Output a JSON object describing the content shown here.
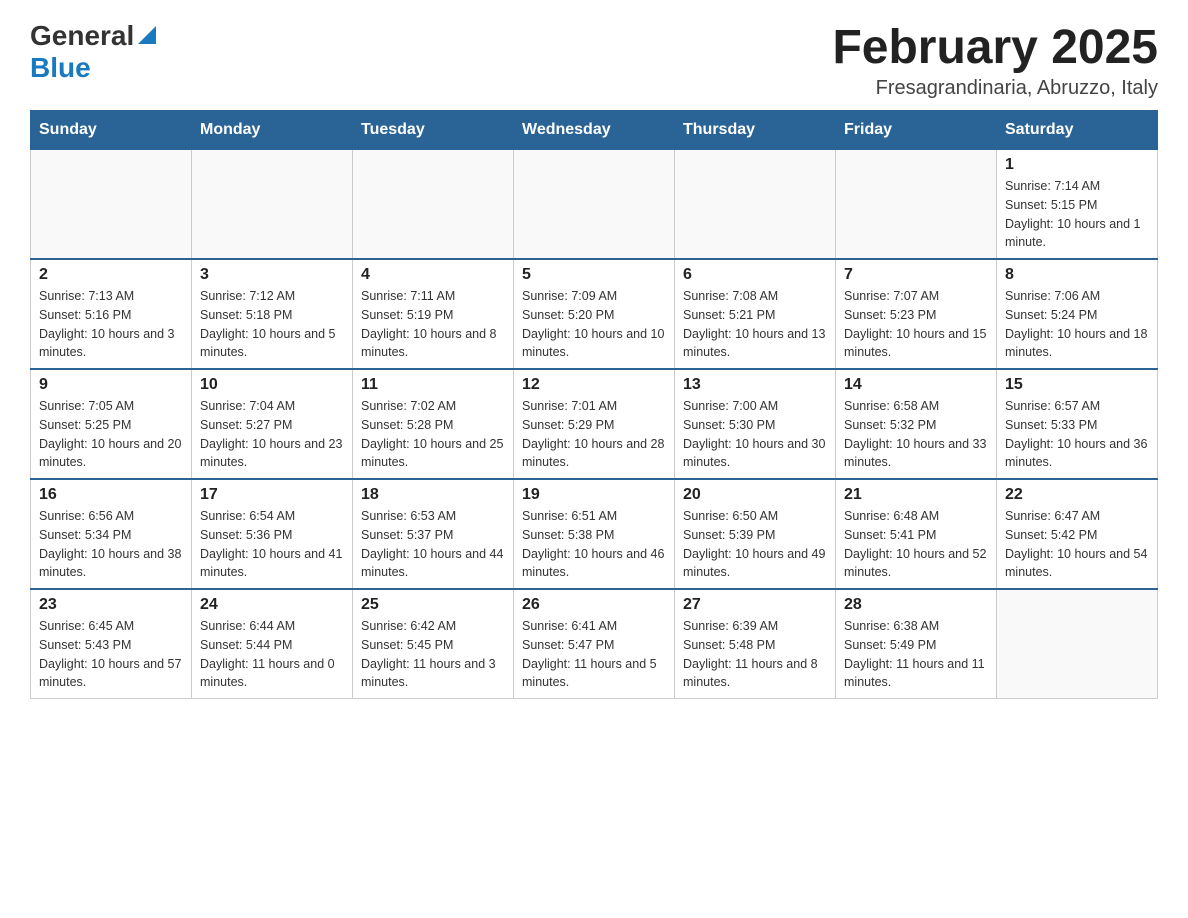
{
  "header": {
    "logo_general": "General",
    "logo_blue": "Blue",
    "title": "February 2025",
    "location": "Fresagrandinaria, Abruzzo, Italy"
  },
  "days_of_week": [
    "Sunday",
    "Monday",
    "Tuesday",
    "Wednesday",
    "Thursday",
    "Friday",
    "Saturday"
  ],
  "weeks": [
    [
      {
        "day": "",
        "sunrise": "",
        "sunset": "",
        "daylight": ""
      },
      {
        "day": "",
        "sunrise": "",
        "sunset": "",
        "daylight": ""
      },
      {
        "day": "",
        "sunrise": "",
        "sunset": "",
        "daylight": ""
      },
      {
        "day": "",
        "sunrise": "",
        "sunset": "",
        "daylight": ""
      },
      {
        "day": "",
        "sunrise": "",
        "sunset": "",
        "daylight": ""
      },
      {
        "day": "",
        "sunrise": "",
        "sunset": "",
        "daylight": ""
      },
      {
        "day": "1",
        "sunrise": "Sunrise: 7:14 AM",
        "sunset": "Sunset: 5:15 PM",
        "daylight": "Daylight: 10 hours and 1 minute."
      }
    ],
    [
      {
        "day": "2",
        "sunrise": "Sunrise: 7:13 AM",
        "sunset": "Sunset: 5:16 PM",
        "daylight": "Daylight: 10 hours and 3 minutes."
      },
      {
        "day": "3",
        "sunrise": "Sunrise: 7:12 AM",
        "sunset": "Sunset: 5:18 PM",
        "daylight": "Daylight: 10 hours and 5 minutes."
      },
      {
        "day": "4",
        "sunrise": "Sunrise: 7:11 AM",
        "sunset": "Sunset: 5:19 PM",
        "daylight": "Daylight: 10 hours and 8 minutes."
      },
      {
        "day": "5",
        "sunrise": "Sunrise: 7:09 AM",
        "sunset": "Sunset: 5:20 PM",
        "daylight": "Daylight: 10 hours and 10 minutes."
      },
      {
        "day": "6",
        "sunrise": "Sunrise: 7:08 AM",
        "sunset": "Sunset: 5:21 PM",
        "daylight": "Daylight: 10 hours and 13 minutes."
      },
      {
        "day": "7",
        "sunrise": "Sunrise: 7:07 AM",
        "sunset": "Sunset: 5:23 PM",
        "daylight": "Daylight: 10 hours and 15 minutes."
      },
      {
        "day": "8",
        "sunrise": "Sunrise: 7:06 AM",
        "sunset": "Sunset: 5:24 PM",
        "daylight": "Daylight: 10 hours and 18 minutes."
      }
    ],
    [
      {
        "day": "9",
        "sunrise": "Sunrise: 7:05 AM",
        "sunset": "Sunset: 5:25 PM",
        "daylight": "Daylight: 10 hours and 20 minutes."
      },
      {
        "day": "10",
        "sunrise": "Sunrise: 7:04 AM",
        "sunset": "Sunset: 5:27 PM",
        "daylight": "Daylight: 10 hours and 23 minutes."
      },
      {
        "day": "11",
        "sunrise": "Sunrise: 7:02 AM",
        "sunset": "Sunset: 5:28 PM",
        "daylight": "Daylight: 10 hours and 25 minutes."
      },
      {
        "day": "12",
        "sunrise": "Sunrise: 7:01 AM",
        "sunset": "Sunset: 5:29 PM",
        "daylight": "Daylight: 10 hours and 28 minutes."
      },
      {
        "day": "13",
        "sunrise": "Sunrise: 7:00 AM",
        "sunset": "Sunset: 5:30 PM",
        "daylight": "Daylight: 10 hours and 30 minutes."
      },
      {
        "day": "14",
        "sunrise": "Sunrise: 6:58 AM",
        "sunset": "Sunset: 5:32 PM",
        "daylight": "Daylight: 10 hours and 33 minutes."
      },
      {
        "day": "15",
        "sunrise": "Sunrise: 6:57 AM",
        "sunset": "Sunset: 5:33 PM",
        "daylight": "Daylight: 10 hours and 36 minutes."
      }
    ],
    [
      {
        "day": "16",
        "sunrise": "Sunrise: 6:56 AM",
        "sunset": "Sunset: 5:34 PM",
        "daylight": "Daylight: 10 hours and 38 minutes."
      },
      {
        "day": "17",
        "sunrise": "Sunrise: 6:54 AM",
        "sunset": "Sunset: 5:36 PM",
        "daylight": "Daylight: 10 hours and 41 minutes."
      },
      {
        "day": "18",
        "sunrise": "Sunrise: 6:53 AM",
        "sunset": "Sunset: 5:37 PM",
        "daylight": "Daylight: 10 hours and 44 minutes."
      },
      {
        "day": "19",
        "sunrise": "Sunrise: 6:51 AM",
        "sunset": "Sunset: 5:38 PM",
        "daylight": "Daylight: 10 hours and 46 minutes."
      },
      {
        "day": "20",
        "sunrise": "Sunrise: 6:50 AM",
        "sunset": "Sunset: 5:39 PM",
        "daylight": "Daylight: 10 hours and 49 minutes."
      },
      {
        "day": "21",
        "sunrise": "Sunrise: 6:48 AM",
        "sunset": "Sunset: 5:41 PM",
        "daylight": "Daylight: 10 hours and 52 minutes."
      },
      {
        "day": "22",
        "sunrise": "Sunrise: 6:47 AM",
        "sunset": "Sunset: 5:42 PM",
        "daylight": "Daylight: 10 hours and 54 minutes."
      }
    ],
    [
      {
        "day": "23",
        "sunrise": "Sunrise: 6:45 AM",
        "sunset": "Sunset: 5:43 PM",
        "daylight": "Daylight: 10 hours and 57 minutes."
      },
      {
        "day": "24",
        "sunrise": "Sunrise: 6:44 AM",
        "sunset": "Sunset: 5:44 PM",
        "daylight": "Daylight: 11 hours and 0 minutes."
      },
      {
        "day": "25",
        "sunrise": "Sunrise: 6:42 AM",
        "sunset": "Sunset: 5:45 PM",
        "daylight": "Daylight: 11 hours and 3 minutes."
      },
      {
        "day": "26",
        "sunrise": "Sunrise: 6:41 AM",
        "sunset": "Sunset: 5:47 PM",
        "daylight": "Daylight: 11 hours and 5 minutes."
      },
      {
        "day": "27",
        "sunrise": "Sunrise: 6:39 AM",
        "sunset": "Sunset: 5:48 PM",
        "daylight": "Daylight: 11 hours and 8 minutes."
      },
      {
        "day": "28",
        "sunrise": "Sunrise: 6:38 AM",
        "sunset": "Sunset: 5:49 PM",
        "daylight": "Daylight: 11 hours and 11 minutes."
      },
      {
        "day": "",
        "sunrise": "",
        "sunset": "",
        "daylight": ""
      }
    ]
  ]
}
